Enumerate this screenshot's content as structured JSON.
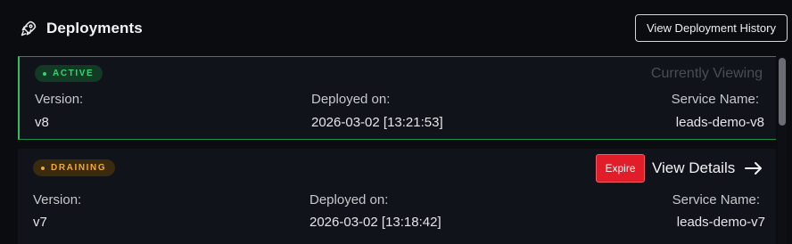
{
  "header": {
    "icon": "rocket-icon",
    "title": "Deployments",
    "history_button": "View Deployment History"
  },
  "deployments": [
    {
      "status": "ACTIVE",
      "status_color": "#36d36f",
      "indicator": "Currently Viewing",
      "version_label": "Version:",
      "version": "v8",
      "deployed_label": "Deployed on:",
      "deployed": "2026-03-02 [13:21:53]",
      "service_label": "Service Name:",
      "service": "leads-demo-v8"
    },
    {
      "status": "DRAINING",
      "status_color": "#f0a83a",
      "expire_button": "Expire",
      "details_link": "View Details",
      "details_icon": "arrow-right-icon",
      "version_label": "Version:",
      "version": "v7",
      "deployed_label": "Deployed on:",
      "deployed": "2026-03-02 [13:18:42]",
      "service_label": "Service Name:",
      "service": "leads-demo-v7"
    }
  ],
  "colors": {
    "background": "#0b0c10",
    "card": "#11131a",
    "active_border": "#2fbf63",
    "expire": "#e11d2a"
  }
}
